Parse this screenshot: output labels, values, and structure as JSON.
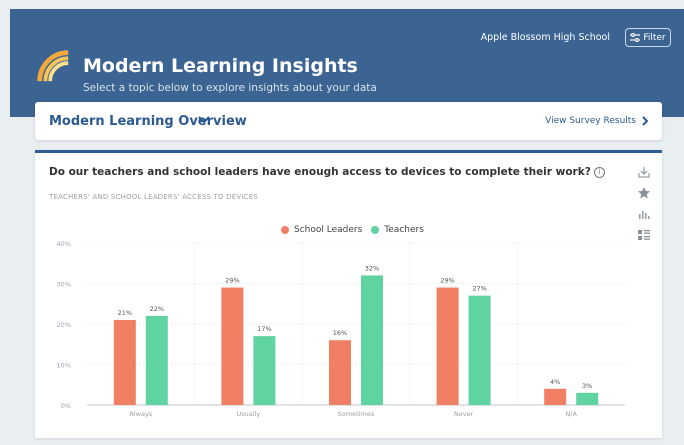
{
  "header": {
    "title": "Modern Learning Insights",
    "subtitle": "Select a topic below to explore insights about your data",
    "school": "Apple Blossom High School",
    "filter_label": "Filter",
    "logo_icon": "rainbow-arc-logo",
    "background": "#3b6493"
  },
  "overview": {
    "title": "Modern Learning Overview",
    "view_results_label": "View Survey Results"
  },
  "card": {
    "question": "Do our teachers and school leaders have enough access to devices to complete their work?",
    "subhead": "TEACHERS' AND SCHOOL LEADERS' ACCESS TO DEVICES",
    "side_icons": [
      "download-icon",
      "star-icon",
      "bar-chart-icon",
      "list-view-icon"
    ]
  },
  "chart_data": {
    "type": "bar",
    "categories": [
      "Always",
      "Usually",
      "Sometimes",
      "Never",
      "N/A"
    ],
    "series": [
      {
        "name": "School Leaders",
        "color": "#f07f64",
        "values": [
          21,
          29,
          16,
          29,
          4
        ]
      },
      {
        "name": "Teachers",
        "color": "#5fd3a0",
        "values": [
          22,
          17,
          32,
          27,
          3
        ]
      }
    ],
    "y_ticks": [
      "0%",
      "10%",
      "20%",
      "30%",
      "40%"
    ],
    "ylim": [
      0,
      40
    ],
    "value_suffix": "%",
    "legend_position": "top-center",
    "grid": true
  }
}
